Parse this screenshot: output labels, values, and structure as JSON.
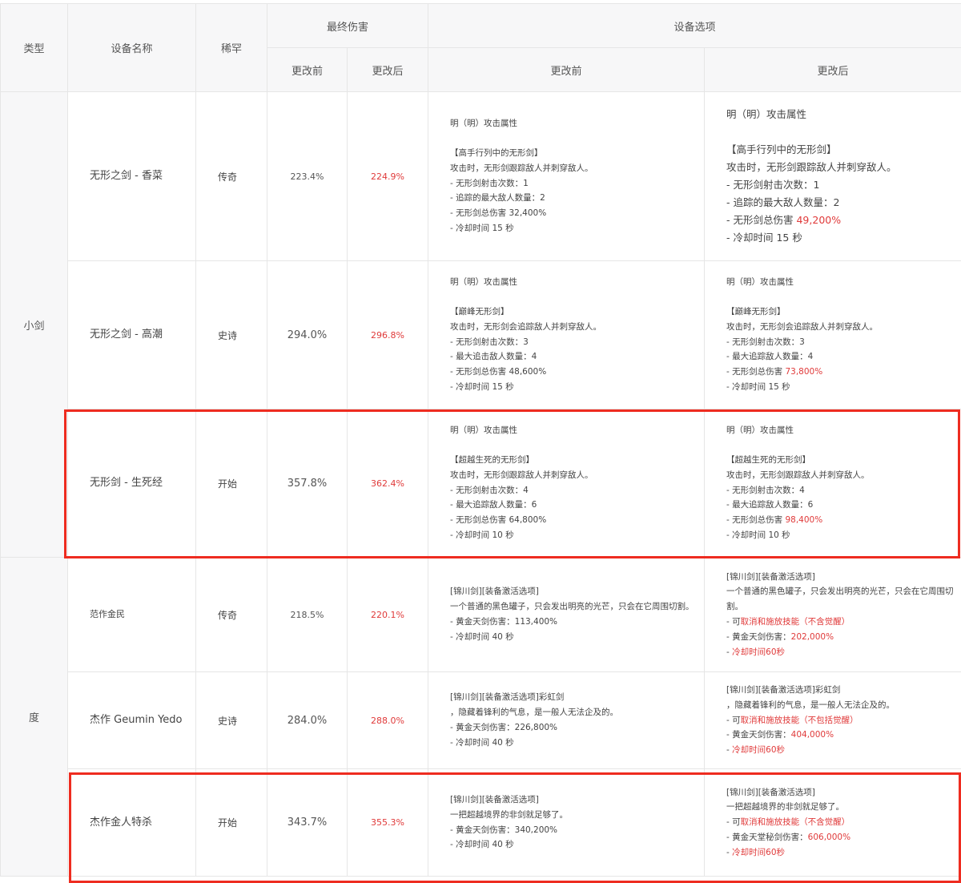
{
  "header": {
    "type": "类型",
    "name": "设备名称",
    "rarity": "稀罕",
    "final_damage": "最终伤害",
    "options": "设备选项",
    "before": "更改前",
    "after": "更改后",
    "opt_before": "更改前",
    "opt_after": "更改后"
  },
  "groups": [
    {
      "type": "小剑"
    },
    {
      "type": "度"
    }
  ],
  "rows": [
    {
      "name": "无形之剑 - 香菜",
      "rarity": "传奇",
      "dmg_before": "223.4%",
      "dmg_after": "224.9%",
      "opt_before": {
        "attr": "明（明）攻击属性",
        "title": "【高手行列中的无形剑】",
        "desc": "攻击时，无形剑跟踪敌人并刺穿敌人。",
        "l1": "- 无形剑射击次数：1",
        "l2": "- 追踪的最大敌人数量：2",
        "l3": "- 无形剑总伤害 32,400%",
        "l4": "- 冷却时间 15 秒"
      },
      "opt_after": {
        "attr": "明（明）攻击属性",
        "title": "【高手行列中的无形剑】",
        "desc": "攻击时，无形剑跟踪敌人并刺穿敌人。",
        "l1": "- 无形剑射击次数：1",
        "l2": "- 追踪的最大敌人数量：2",
        "l3_pre": "- 无形剑总伤害 ",
        "l3_hl": "49,200%",
        "l4": "- 冷却时间 15 秒"
      }
    },
    {
      "name": "无形之剑 - 高潮",
      "rarity": "史诗",
      "dmg_before": "294.0%",
      "dmg_after": "296.8%",
      "opt_before": {
        "attr": "明（明）攻击属性",
        "title": "【巅峰无形剑】",
        "desc": "攻击时，无形剑会追踪敌人并刺穿敌人。",
        "l1": "- 无形剑射击次数：3",
        "l2": "- 最大追击敌人数量：4",
        "l3": "- 无形剑总伤害 48,600%",
        "l4": "- 冷却时间 15 秒"
      },
      "opt_after": {
        "attr": "明（明）攻击属性",
        "title": "【巅峰无形剑】",
        "desc": "攻击时，无形剑会追踪敌人并刺穿敌人。",
        "l1": "- 无形剑射击次数：3",
        "l2": "- 最大追踪敌人数量：4",
        "l3_pre": "- 无形剑总伤害 ",
        "l3_hl": "73,800%",
        "l4": "- 冷却时间 15 秒"
      }
    },
    {
      "name": "无形剑 - 生死经",
      "rarity": "开始",
      "dmg_before": "357.8%",
      "dmg_after": "362.4%",
      "opt_before": {
        "attr": "明（明）攻击属性",
        "title": "【超越生死的无形剑】",
        "desc": "攻击时，无形剑跟踪敌人并刺穿敌人。",
        "l1": "- 无形剑射击次数：4",
        "l2": "- 最大追踪敌人数量：6",
        "l3": "- 无形剑总伤害 64,800%",
        "l4": "- 冷却时间 10 秒"
      },
      "opt_after": {
        "attr": "明（明）攻击属性",
        "title": "【超越生死的无形剑】",
        "desc": "攻击时，无形剑跟踪敌人并刺穿敌人。",
        "l1": "- 无形剑射击次数：4",
        "l2": "- 最大追踪敌人数量：6",
        "l3_pre": "- 无形剑总伤害 ",
        "l3_hl": "98,400%",
        "l4": "- 冷却时间 10 秒"
      }
    },
    {
      "name": "范作金民",
      "rarity": "传奇",
      "dmg_before": "218.5%",
      "dmg_after": "220.1%",
      "opt_before": {
        "title": "[锦川剑][装备激活选项]",
        "desc": "一个普通的黑色罐子，只会发出明亮的光芒，只会在它周围切割。",
        "l1": "- 黄金天剑伤害：113,400%",
        "l2": "- 冷却时间 40 秒"
      },
      "opt_after": {
        "title": "[锦川剑][装备激活选项]",
        "desc": "一个普通的黑色罐子，只会发出明亮的光芒，只会在它周围切割。",
        "skill_pre": "- 可",
        "skill_hl": "取消和施放技能（不含觉醒）",
        "dmg_pre": "- 黄金天剑伤害：",
        "dmg_hl": "202,000%",
        "cd_pre": "- ",
        "cd_hl": "冷却时间60秒"
      }
    },
    {
      "name": "杰作 Geumin Yedo",
      "rarity": "史诗",
      "dmg_before": "284.0%",
      "dmg_after": "288.0%",
      "opt_before": {
        "title": "[锦川剑][装备激活选项]彩虹剑",
        "desc": "，隐藏着锋利的气息，是一般人无法企及的。",
        "l1": "- 黄金天剑伤害：226,800%",
        "l2": "- 冷却时间 40 秒"
      },
      "opt_after": {
        "title": "[锦川剑][装备激活选项]彩虹剑",
        "desc": "，隐藏着锋利的气息，是一般人无法企及的。",
        "skill_pre": "- 可",
        "skill_hl": "取消和施放技能（不包括觉醒）",
        "dmg_pre": "- 黄金天剑伤害：",
        "dmg_hl": "404,000%",
        "cd_pre": "- ",
        "cd_hl": "冷却时间60秒"
      }
    },
    {
      "name": "杰作金人特杀",
      "rarity": "开始",
      "dmg_before": "343.7%",
      "dmg_after": "355.3%",
      "opt_before": {
        "title": "[锦川剑][装备激活选项]",
        "desc": "一把超越境界的非剑就足够了。",
        "l1": "- 黄金天剑伤害：340,200%",
        "l2": "- 冷却时间 40 秒"
      },
      "opt_after": {
        "title": "[锦川剑][装备激活选项]",
        "desc": "一把超越境界的非剑就足够了。",
        "skill_pre": "- 可",
        "skill_hl": "取消和施放技能（不含觉醒）",
        "dmg_pre": "- 黄金天堂秘剑伤害：",
        "dmg_hl": "606,000%",
        "cd_pre": "- ",
        "cd_hl": "冷却时间60秒"
      }
    }
  ],
  "colors": {
    "highlight_text": "#e03a3a",
    "highlight_box": "#ee2c20",
    "header_bg": "#f7f7f8",
    "border": "#e6e6e6"
  }
}
